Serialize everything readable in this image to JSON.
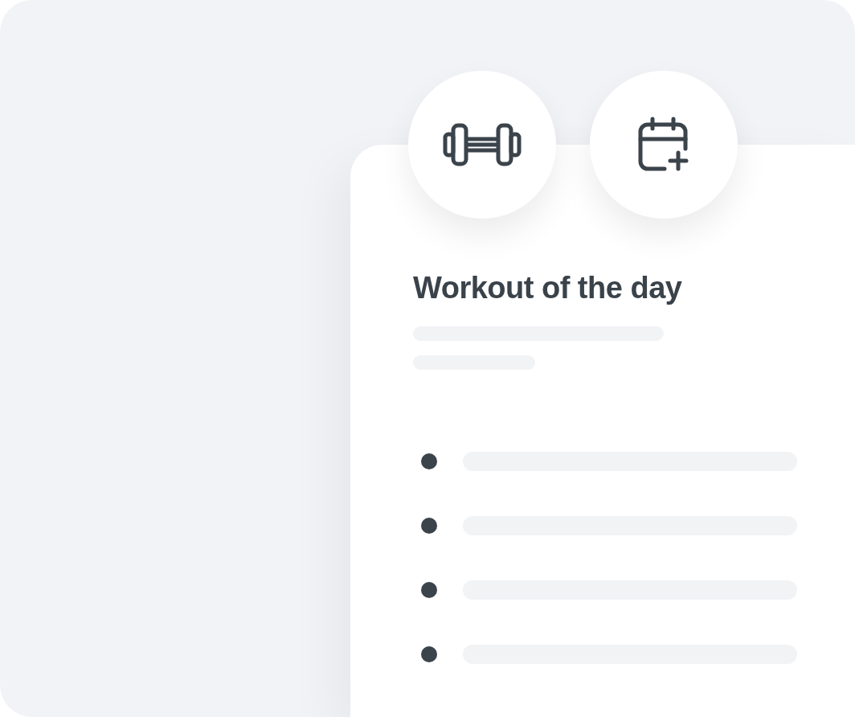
{
  "icon_buttons": [
    {
      "kind": "dumbbell"
    },
    {
      "kind": "calendar-add"
    }
  ],
  "card": {
    "title": "Workout of the day"
  }
}
